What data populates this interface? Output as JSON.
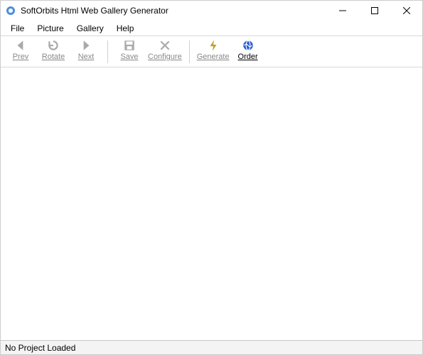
{
  "titlebar": {
    "title": "SoftOrbits Html Web Gallery Generator"
  },
  "menubar": {
    "items": [
      {
        "label": "File"
      },
      {
        "label": "Picture"
      },
      {
        "label": "Gallery"
      },
      {
        "label": "Help"
      }
    ]
  },
  "toolbar": {
    "prev": "Prev",
    "rotate": "Rotate",
    "next": "Next",
    "save": "Save",
    "configure": "Configure",
    "generate": "Generate",
    "order": "Order"
  },
  "statusbar": {
    "text": "No Project Loaded"
  }
}
